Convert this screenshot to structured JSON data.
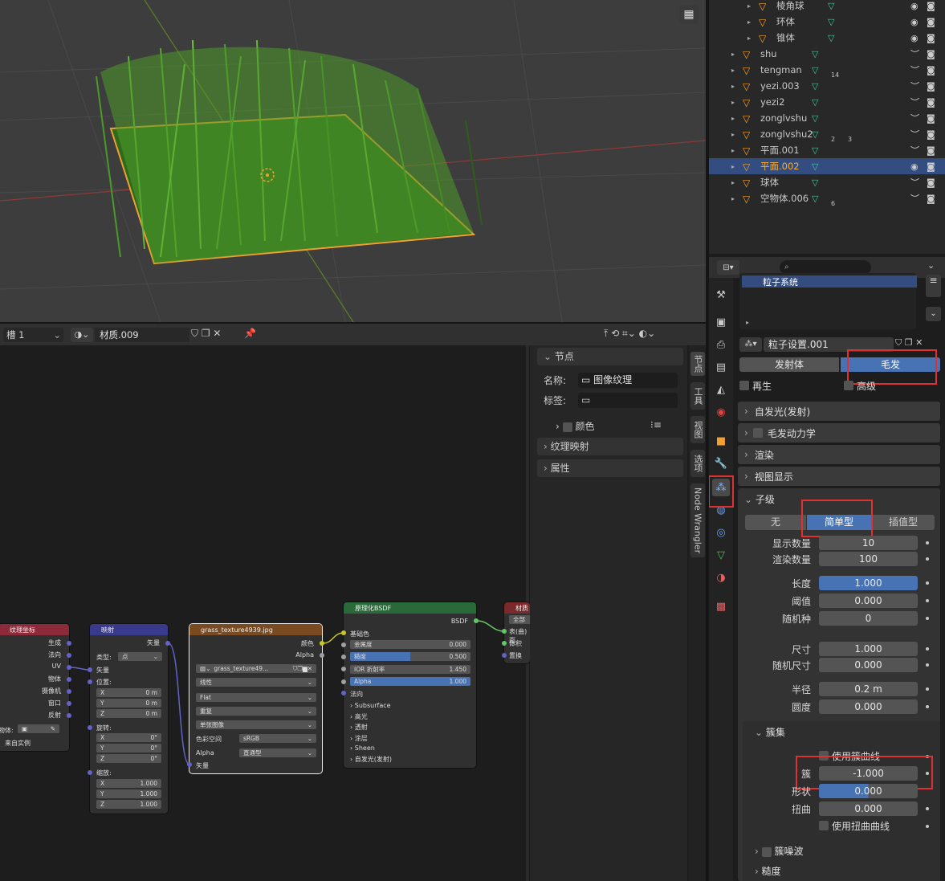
{
  "outliner": {
    "rows": [
      {
        "name": "棱角球",
        "indent": 3,
        "badge": ""
      },
      {
        "name": "环体",
        "indent": 3,
        "badge": ""
      },
      {
        "name": "锥体",
        "indent": 3,
        "badge": ""
      },
      {
        "name": "shu",
        "indent": 2,
        "badge": ""
      },
      {
        "name": "tengman",
        "indent": 2,
        "badge": "14"
      },
      {
        "name": "yezi.003",
        "indent": 2,
        "badge": ""
      },
      {
        "name": "yezi2",
        "indent": 2,
        "badge": ""
      },
      {
        "name": "zonglvshu",
        "indent": 2,
        "badge": ""
      },
      {
        "name": "zonglvshu2",
        "indent": 2,
        "badge": "2",
        "badge2": "3"
      },
      {
        "name": "平面.001",
        "indent": 2,
        "badge": ""
      },
      {
        "name": "平面.002",
        "indent": 2,
        "badge": "",
        "selected": true
      },
      {
        "name": "球体",
        "indent": 2,
        "badge": ""
      },
      {
        "name": "空物体.006",
        "indent": 2,
        "badge": "6"
      }
    ]
  },
  "node_header": {
    "slot": "槽 1",
    "material": "材质.009"
  },
  "node_sidebar": {
    "section_node": "节点",
    "name_label": "名称:",
    "name_value": "图像纹理",
    "label_label": "标签:",
    "color_label": "颜色",
    "texture_mapping": "纹理映射",
    "properties": "属性",
    "tabs": [
      "节点",
      "工具",
      "视图",
      "选项",
      "Node Wrangler"
    ]
  },
  "nodes": {
    "texcoord": {
      "title": "纹理坐标",
      "outputs": [
        "生成",
        "法向",
        "UV",
        "物体",
        "摄像机",
        "窗口",
        "反射"
      ],
      "object_label": "物体:",
      "from_instancer": "来自实例"
    },
    "mapping": {
      "title": "映射",
      "out": "矢量",
      "type_label": "类型:",
      "type_value": "点",
      "vector": "矢量",
      "location": "位置:",
      "loc": [
        "0 m",
        "0 m",
        "0 m"
      ],
      "rotation": "旋转:",
      "rot": [
        "0°",
        "0°",
        "0°"
      ],
      "scale": "缩放:",
      "scl": [
        "1.000",
        "1.000",
        "1.000"
      ],
      "axes": [
        "X",
        "Y",
        "Z"
      ]
    },
    "image": {
      "title": "grass_texture4939.jpg",
      "out_color": "颜色",
      "out_alpha": "Alpha",
      "image_name": "grass_texture49...",
      "interp": "线性",
      "proj": "Flat",
      "ext": "重复",
      "source": "单张图像",
      "colorspace_label": "色彩空间",
      "colorspace": "sRGB",
      "alpha_label": "Alpha",
      "alpha": "直通型",
      "vector": "矢量"
    },
    "bsdf": {
      "title": "原理化BSDF",
      "out": "BSDF",
      "base_color": "基础色",
      "metallic": "金属度",
      "metallic_v": "0.000",
      "roughness": "糙度",
      "roughness_v": "0.500",
      "ior": "IOR 折射率",
      "ior_v": "1.450",
      "alpha": "Alpha",
      "alpha_v": "1.000",
      "normal": "法向",
      "subs": [
        "Subsurface",
        "高光",
        "透射",
        "涂层",
        "Sheen",
        "自发光(发射)"
      ]
    },
    "output": {
      "title": "材质",
      "target": "全部",
      "sockets": [
        "表(曲)面",
        "体积",
        "置换"
      ]
    }
  },
  "props": {
    "particle_system": "粒子系统",
    "settings_name": "粒子设置.001",
    "type_emitter": "发射体",
    "type_hair": "毛发",
    "regrow": "再生",
    "advanced": "高级",
    "panels": [
      "自发光(发射)",
      "毛发动力学",
      "渲染",
      "视图显示"
    ],
    "children": "子级",
    "child_opts": [
      "无",
      "简单型",
      "插值型"
    ],
    "display_amount_label": "显示数量",
    "display_amount": "10",
    "render_amount_label": "渲染数量",
    "render_amount": "100",
    "length_label": "长度",
    "length": "1.000",
    "threshold_label": "阈值",
    "threshold": "0.000",
    "seed_label": "随机种",
    "seed": "0",
    "size_label": "尺寸",
    "size": "1.000",
    "rand_size_label": "随机尺寸",
    "rand_size": "0.000",
    "radius_label": "半径",
    "radius": "0.2 m",
    "roundness_label": "圆度",
    "roundness": "0.000",
    "clumping": "簇集",
    "use_clump_curve": "使用簇曲线",
    "clump_label": "簇",
    "clump": "-1.000",
    "shape_label": "形状",
    "shape": "0.000",
    "twist_label": "扭曲",
    "twist": "0.000",
    "use_twist_curve": "使用扭曲曲线",
    "clump_noise": "簇噪波",
    "roughness": "糙度"
  },
  "colors": {
    "accent": "#4772b3",
    "selected_row": "#334d80",
    "highlight_red": "#e03030",
    "active_orange": "#ffaf29"
  }
}
